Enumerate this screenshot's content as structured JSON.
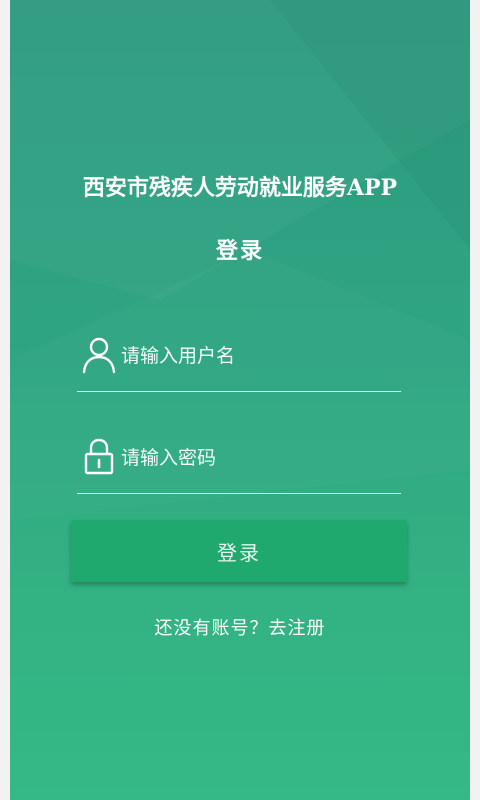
{
  "header": {
    "app_title": "西安市残疾人劳动就业服务APP",
    "login_heading": "登录"
  },
  "form": {
    "username": {
      "placeholder": "请输入用户名",
      "value": "",
      "icon": "user-icon"
    },
    "password": {
      "placeholder": "请输入密码",
      "value": "",
      "icon": "lock-icon"
    },
    "login_button_label": "登录",
    "register_link": "还没有账号？去注册"
  },
  "colors": {
    "background_top": "#2e9a80",
    "background_bottom": "#35b985",
    "button": "#1fa96f",
    "text": "#ffffff"
  }
}
